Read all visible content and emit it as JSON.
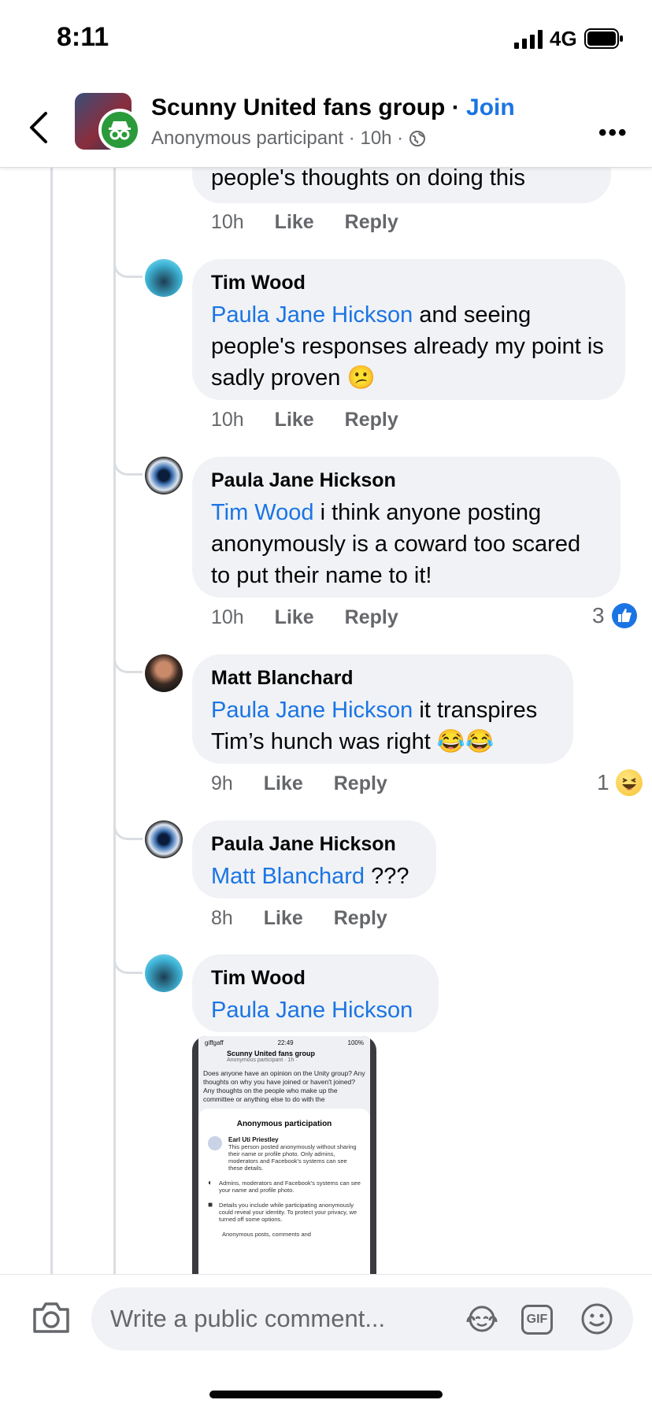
{
  "status_bar": {
    "time": "8:11",
    "network": "4G"
  },
  "header": {
    "group_name": "Scunny United fans group",
    "separator": "·",
    "join_label": "Join",
    "subtitle": "Anonymous participant · 10h ·",
    "icons": [
      "back-arrow-icon",
      "anonymous-icon",
      "globe-icon",
      "more-icon"
    ]
  },
  "partial_comment": {
    "text": "people's thoughts on doing this",
    "time": "10h",
    "like": "Like",
    "reply": "Reply"
  },
  "comments": [
    {
      "author": "Tim Wood",
      "mention": "Paula Jane Hickson",
      "text_1": " and seeing people's responses already my point is sadly proven ",
      "emoji": "😕",
      "time": "10h",
      "like": "Like",
      "reply": "Reply"
    },
    {
      "author": "Paula Jane Hickson",
      "mention": "Tim Wood",
      "text_1": " i think anyone posting anonymously is a coward too scared to put their name to it!",
      "time": "10h",
      "like": "Like",
      "reply": "Reply",
      "reaction_count": "3",
      "reaction_icon": "like-icon"
    },
    {
      "author": "Matt Blanchard",
      "mention": "Paula Jane Hickson",
      "text_1": " it transpires Tim’s hunch was right ",
      "emoji": "😂😂",
      "time": "9h",
      "like": "Like",
      "reply": "Reply",
      "reaction_count": "1",
      "reaction_icon": "haha-icon"
    },
    {
      "author": "Paula Jane Hickson",
      "mention": "Matt Blanchard",
      "text_1": " ???",
      "time": "8h",
      "like": "Like",
      "reply": "Reply"
    },
    {
      "author": "Tim Wood",
      "mention": "Paula Jane Hickson"
    }
  ],
  "attached_screenshot": {
    "carrier": "giffgaff",
    "time": "22:49",
    "battery": "100%",
    "group_name": "Scunny United fans group",
    "subtitle": "Anonymous participant · 1h ·",
    "post_text": "Does anyone have an opinion on the Unity group? Any thoughts on why you have joined or haven't joined? Any thoughts on the people who make up the committee or anything else to do with the",
    "sheet_title": "Anonymous participation",
    "revealed_name": "Earl Uti Priestley",
    "revealed_desc": "This person posted anonymously without sharing their name or profile photo. Only admins, moderators and Facebook's systems can see these details.",
    "row_1": "Admins, moderators and Facebook's systems can see your name and profile photo.",
    "row_2": "Details you include while participating anonymously could reveal your identity. To protect your privacy, we turned off some options.",
    "row_3": "Anonymous posts, comments and"
  },
  "composer": {
    "placeholder": "Write a public comment...",
    "gif_label": "GIF",
    "icons": [
      "camera-icon",
      "avatar-sticker-icon",
      "gif-icon",
      "emoji-icon"
    ]
  }
}
